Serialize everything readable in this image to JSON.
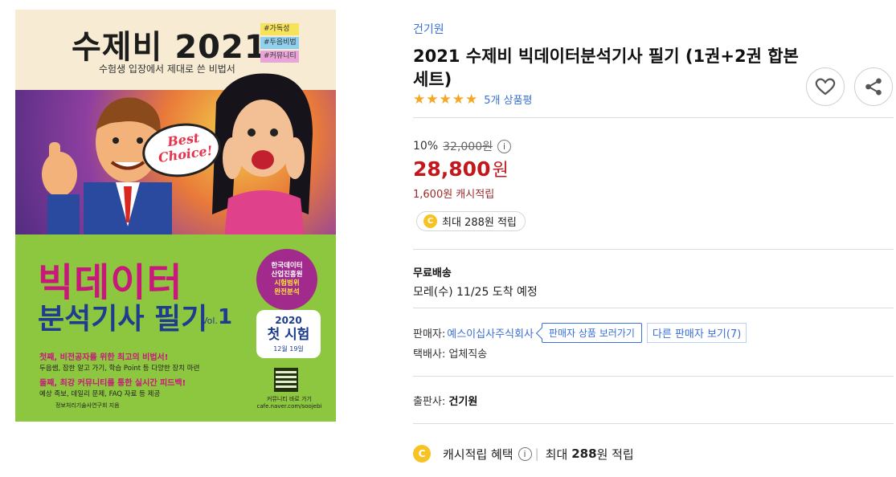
{
  "cover": {
    "title": "수제비 2021",
    "subtitle": "수험생 입장에서 제대로 쓴 비법서",
    "tags": [
      "#가독성",
      "#두음비법",
      "#커뮤니티"
    ],
    "bubble_line1": "Best",
    "bubble_line2": "Choice!",
    "main_title1": "빅데이터",
    "main_title2": "분석기사 필기",
    "vol_label": "Vol.",
    "vol_num": "1",
    "seal_lines": [
      "한국데이터",
      "산업진흥원",
      "시험범위",
      "완전분석"
    ],
    "exam_year": "2020",
    "exam_label": "첫 시험",
    "exam_date": "12월 19일",
    "feature1": "첫째, 비전공자를 위한 최고의 비법서!",
    "feature1_desc": "두음쌤, 잠한 알고 가기, 학습 Point 등 다양한 장치 마련",
    "feature2": "둘째, 최강 커뮤니티를 통한 실시간 피드백!",
    "feature2_desc": "예상 족보, 데일리 문제, FAQ 자료 등 제공",
    "qr_caption1": "커뮤니티 바로 가기",
    "qr_caption2": "cafe.naver.com/soojebi",
    "publisher": "정보처리기술사연구회 지음"
  },
  "product": {
    "author": "건기원",
    "title": "2021 수제비 빅데이터분석기사 필기 (1권+2권 합본세트)",
    "rating_stars": 5,
    "review_count": "5개 상품평",
    "discount": "10%",
    "original_price": "32,000원",
    "info_glyph": "i",
    "price": "28,800",
    "price_unit": "원",
    "cash_reward": "1,600원 캐시적립",
    "coin_glyph": "C",
    "max_reward": "최대 288원 적립"
  },
  "shipping": {
    "title": "무료배송",
    "eta": "모레(수) 11/25 도착 예정"
  },
  "seller": {
    "label": "판매자:",
    "name": "예스이십사주식회사",
    "view_products": "판매자 상품 보러가기",
    "other_sellers": "다른 판매자 보기(7)",
    "delivery": "택배사: 업체직송"
  },
  "publisher": {
    "label": "출판사:",
    "name": "건기원"
  },
  "benefit": {
    "label": "캐시적립 혜택",
    "separator": "|",
    "prefix": "최대",
    "amount": "288",
    "suffix": "원 적립"
  },
  "colors": {
    "link_blue": "#3a6fd6",
    "price_red": "#c4171c",
    "star_gold": "#f5a623",
    "coin_yellow": "#f7c324"
  },
  "icons": [
    "star-icon",
    "heart-icon",
    "share-icon",
    "info-icon",
    "cash-coin-icon"
  ]
}
